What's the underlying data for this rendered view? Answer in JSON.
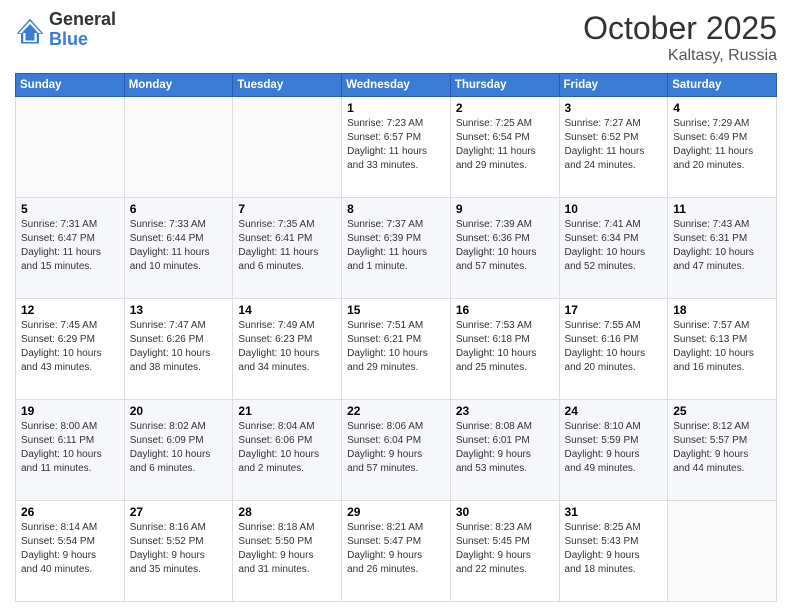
{
  "logo": {
    "general": "General",
    "blue": "Blue"
  },
  "header": {
    "month": "October 2025",
    "location": "Kaltasy, Russia"
  },
  "weekdays": [
    "Sunday",
    "Monday",
    "Tuesday",
    "Wednesday",
    "Thursday",
    "Friday",
    "Saturday"
  ],
  "weeks": [
    [
      {
        "day": "",
        "info": ""
      },
      {
        "day": "",
        "info": ""
      },
      {
        "day": "",
        "info": ""
      },
      {
        "day": "1",
        "info": "Sunrise: 7:23 AM\nSunset: 6:57 PM\nDaylight: 11 hours\nand 33 minutes."
      },
      {
        "day": "2",
        "info": "Sunrise: 7:25 AM\nSunset: 6:54 PM\nDaylight: 11 hours\nand 29 minutes."
      },
      {
        "day": "3",
        "info": "Sunrise: 7:27 AM\nSunset: 6:52 PM\nDaylight: 11 hours\nand 24 minutes."
      },
      {
        "day": "4",
        "info": "Sunrise: 7:29 AM\nSunset: 6:49 PM\nDaylight: 11 hours\nand 20 minutes."
      }
    ],
    [
      {
        "day": "5",
        "info": "Sunrise: 7:31 AM\nSunset: 6:47 PM\nDaylight: 11 hours\nand 15 minutes."
      },
      {
        "day": "6",
        "info": "Sunrise: 7:33 AM\nSunset: 6:44 PM\nDaylight: 11 hours\nand 10 minutes."
      },
      {
        "day": "7",
        "info": "Sunrise: 7:35 AM\nSunset: 6:41 PM\nDaylight: 11 hours\nand 6 minutes."
      },
      {
        "day": "8",
        "info": "Sunrise: 7:37 AM\nSunset: 6:39 PM\nDaylight: 11 hours\nand 1 minute."
      },
      {
        "day": "9",
        "info": "Sunrise: 7:39 AM\nSunset: 6:36 PM\nDaylight: 10 hours\nand 57 minutes."
      },
      {
        "day": "10",
        "info": "Sunrise: 7:41 AM\nSunset: 6:34 PM\nDaylight: 10 hours\nand 52 minutes."
      },
      {
        "day": "11",
        "info": "Sunrise: 7:43 AM\nSunset: 6:31 PM\nDaylight: 10 hours\nand 47 minutes."
      }
    ],
    [
      {
        "day": "12",
        "info": "Sunrise: 7:45 AM\nSunset: 6:29 PM\nDaylight: 10 hours\nand 43 minutes."
      },
      {
        "day": "13",
        "info": "Sunrise: 7:47 AM\nSunset: 6:26 PM\nDaylight: 10 hours\nand 38 minutes."
      },
      {
        "day": "14",
        "info": "Sunrise: 7:49 AM\nSunset: 6:23 PM\nDaylight: 10 hours\nand 34 minutes."
      },
      {
        "day": "15",
        "info": "Sunrise: 7:51 AM\nSunset: 6:21 PM\nDaylight: 10 hours\nand 29 minutes."
      },
      {
        "day": "16",
        "info": "Sunrise: 7:53 AM\nSunset: 6:18 PM\nDaylight: 10 hours\nand 25 minutes."
      },
      {
        "day": "17",
        "info": "Sunrise: 7:55 AM\nSunset: 6:16 PM\nDaylight: 10 hours\nand 20 minutes."
      },
      {
        "day": "18",
        "info": "Sunrise: 7:57 AM\nSunset: 6:13 PM\nDaylight: 10 hours\nand 16 minutes."
      }
    ],
    [
      {
        "day": "19",
        "info": "Sunrise: 8:00 AM\nSunset: 6:11 PM\nDaylight: 10 hours\nand 11 minutes."
      },
      {
        "day": "20",
        "info": "Sunrise: 8:02 AM\nSunset: 6:09 PM\nDaylight: 10 hours\nand 6 minutes."
      },
      {
        "day": "21",
        "info": "Sunrise: 8:04 AM\nSunset: 6:06 PM\nDaylight: 10 hours\nand 2 minutes."
      },
      {
        "day": "22",
        "info": "Sunrise: 8:06 AM\nSunset: 6:04 PM\nDaylight: 9 hours\nand 57 minutes."
      },
      {
        "day": "23",
        "info": "Sunrise: 8:08 AM\nSunset: 6:01 PM\nDaylight: 9 hours\nand 53 minutes."
      },
      {
        "day": "24",
        "info": "Sunrise: 8:10 AM\nSunset: 5:59 PM\nDaylight: 9 hours\nand 49 minutes."
      },
      {
        "day": "25",
        "info": "Sunrise: 8:12 AM\nSunset: 5:57 PM\nDaylight: 9 hours\nand 44 minutes."
      }
    ],
    [
      {
        "day": "26",
        "info": "Sunrise: 8:14 AM\nSunset: 5:54 PM\nDaylight: 9 hours\nand 40 minutes."
      },
      {
        "day": "27",
        "info": "Sunrise: 8:16 AM\nSunset: 5:52 PM\nDaylight: 9 hours\nand 35 minutes."
      },
      {
        "day": "28",
        "info": "Sunrise: 8:18 AM\nSunset: 5:50 PM\nDaylight: 9 hours\nand 31 minutes."
      },
      {
        "day": "29",
        "info": "Sunrise: 8:21 AM\nSunset: 5:47 PM\nDaylight: 9 hours\nand 26 minutes."
      },
      {
        "day": "30",
        "info": "Sunrise: 8:23 AM\nSunset: 5:45 PM\nDaylight: 9 hours\nand 22 minutes."
      },
      {
        "day": "31",
        "info": "Sunrise: 8:25 AM\nSunset: 5:43 PM\nDaylight: 9 hours\nand 18 minutes."
      },
      {
        "day": "",
        "info": ""
      }
    ]
  ]
}
